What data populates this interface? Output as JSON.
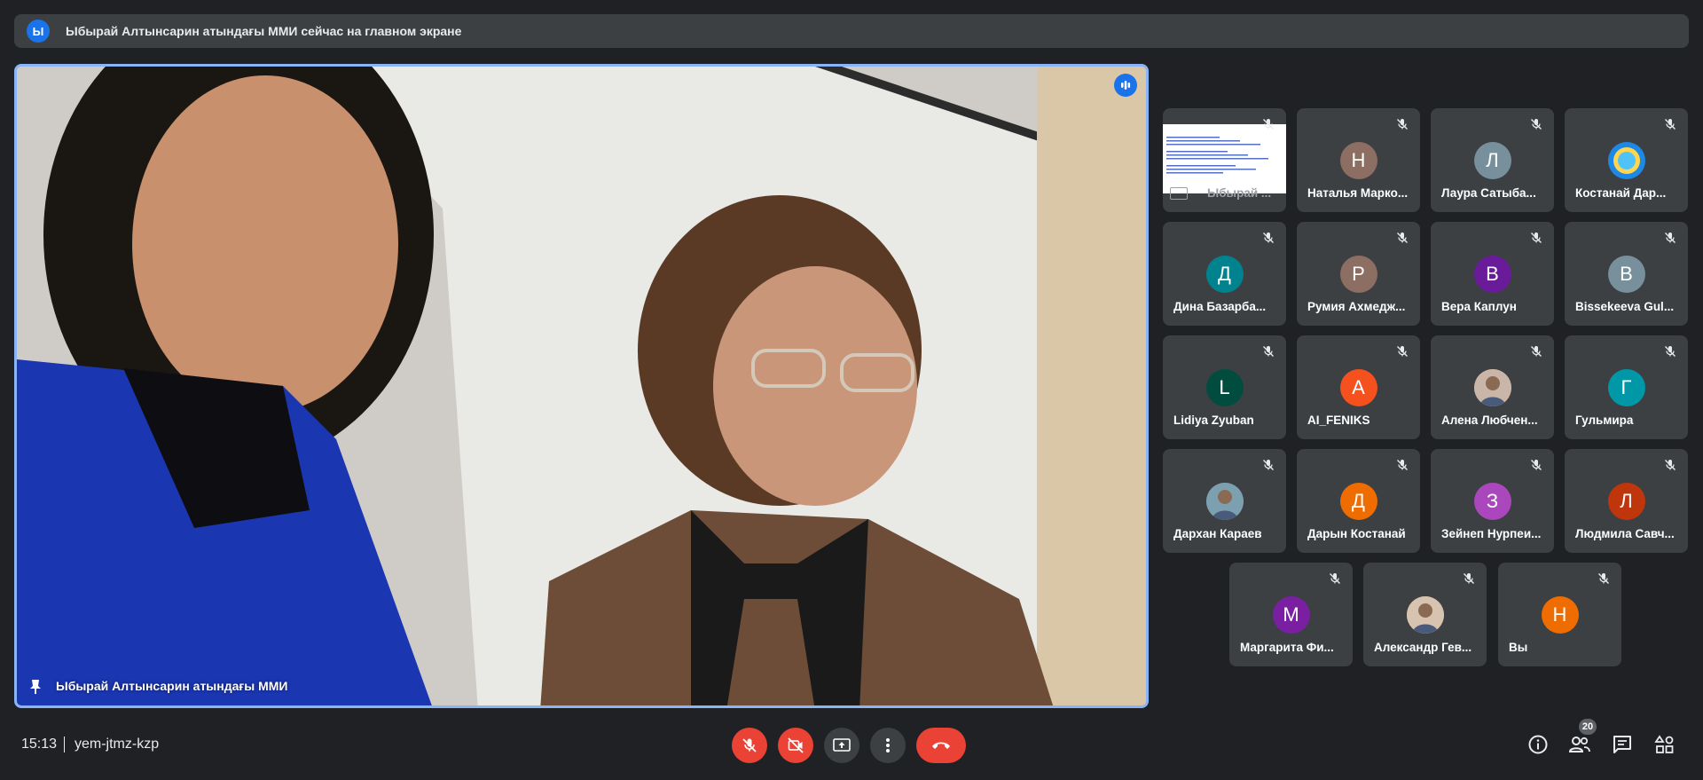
{
  "banner": {
    "avatar_letter": "Ы",
    "text": "Ыбырай Алтынсарин атындағы ММИ сейчас на главном экране"
  },
  "main_video": {
    "name": "Ыбырай Алтынсарин атындағы ММИ"
  },
  "tiles": [
    {
      "name": "Ыбырай ...",
      "letter": "",
      "color": "",
      "type": "screen"
    },
    {
      "name": "Наталья Марко...",
      "letter": "Н",
      "color": "#8d6e63"
    },
    {
      "name": "Лаура Сатыба...",
      "letter": "Л",
      "color": "#78909c"
    },
    {
      "name": "Костанай Дар...",
      "letter": "",
      "color": "#1e88e5",
      "type": "logo"
    },
    {
      "name": "Дина Базарба...",
      "letter": "Д",
      "color": "#00838f"
    },
    {
      "name": "Румия Ахмедж...",
      "letter": "Р",
      "color": "#8d6e63"
    },
    {
      "name": "Вера Каплун",
      "letter": "В",
      "color": "#6a1b9a"
    },
    {
      "name": "Bissekeeva Gul...",
      "letter": "В",
      "color": "#78909c"
    },
    {
      "name": "Lidiya Zyuban",
      "letter": "L",
      "color": "#004d40"
    },
    {
      "name": "AI_FENIKS",
      "letter": "A",
      "color": "#f4511e"
    },
    {
      "name": "Алена Любчен...",
      "letter": "",
      "color": "#c9b6a8",
      "type": "photo"
    },
    {
      "name": "Гульмира",
      "letter": "Г",
      "color": "#0097a7"
    },
    {
      "name": "Дархан Караев",
      "letter": "",
      "color": "#7da0b0",
      "type": "photo"
    },
    {
      "name": "Дарын Костанай",
      "letter": "Д",
      "color": "#ef6c00"
    },
    {
      "name": "Зейнеп Нурпеи...",
      "letter": "З",
      "color": "#ab47bc"
    },
    {
      "name": "Людмила Савч...",
      "letter": "Л",
      "color": "#bf360c"
    },
    {
      "name": "Маргарита Фи...",
      "letter": "М",
      "color": "#7b1fa2"
    },
    {
      "name": "Александр Гев...",
      "letter": "",
      "color": "#d7c4b0",
      "type": "photo"
    },
    {
      "name": "Вы",
      "letter": "Н",
      "color": "#ef6c00"
    }
  ],
  "bottom": {
    "time": "15:13",
    "meeting_code": "yem-jtmz-kzp",
    "participants_count": "20"
  },
  "icons": {
    "mic": "mic-off-icon",
    "camera": "camera-off-icon",
    "present": "present-icon",
    "more": "more-vert-icon",
    "end": "call-end-icon",
    "info": "info-icon",
    "people": "people-icon",
    "chat": "chat-icon",
    "activities": "activities-icon"
  }
}
